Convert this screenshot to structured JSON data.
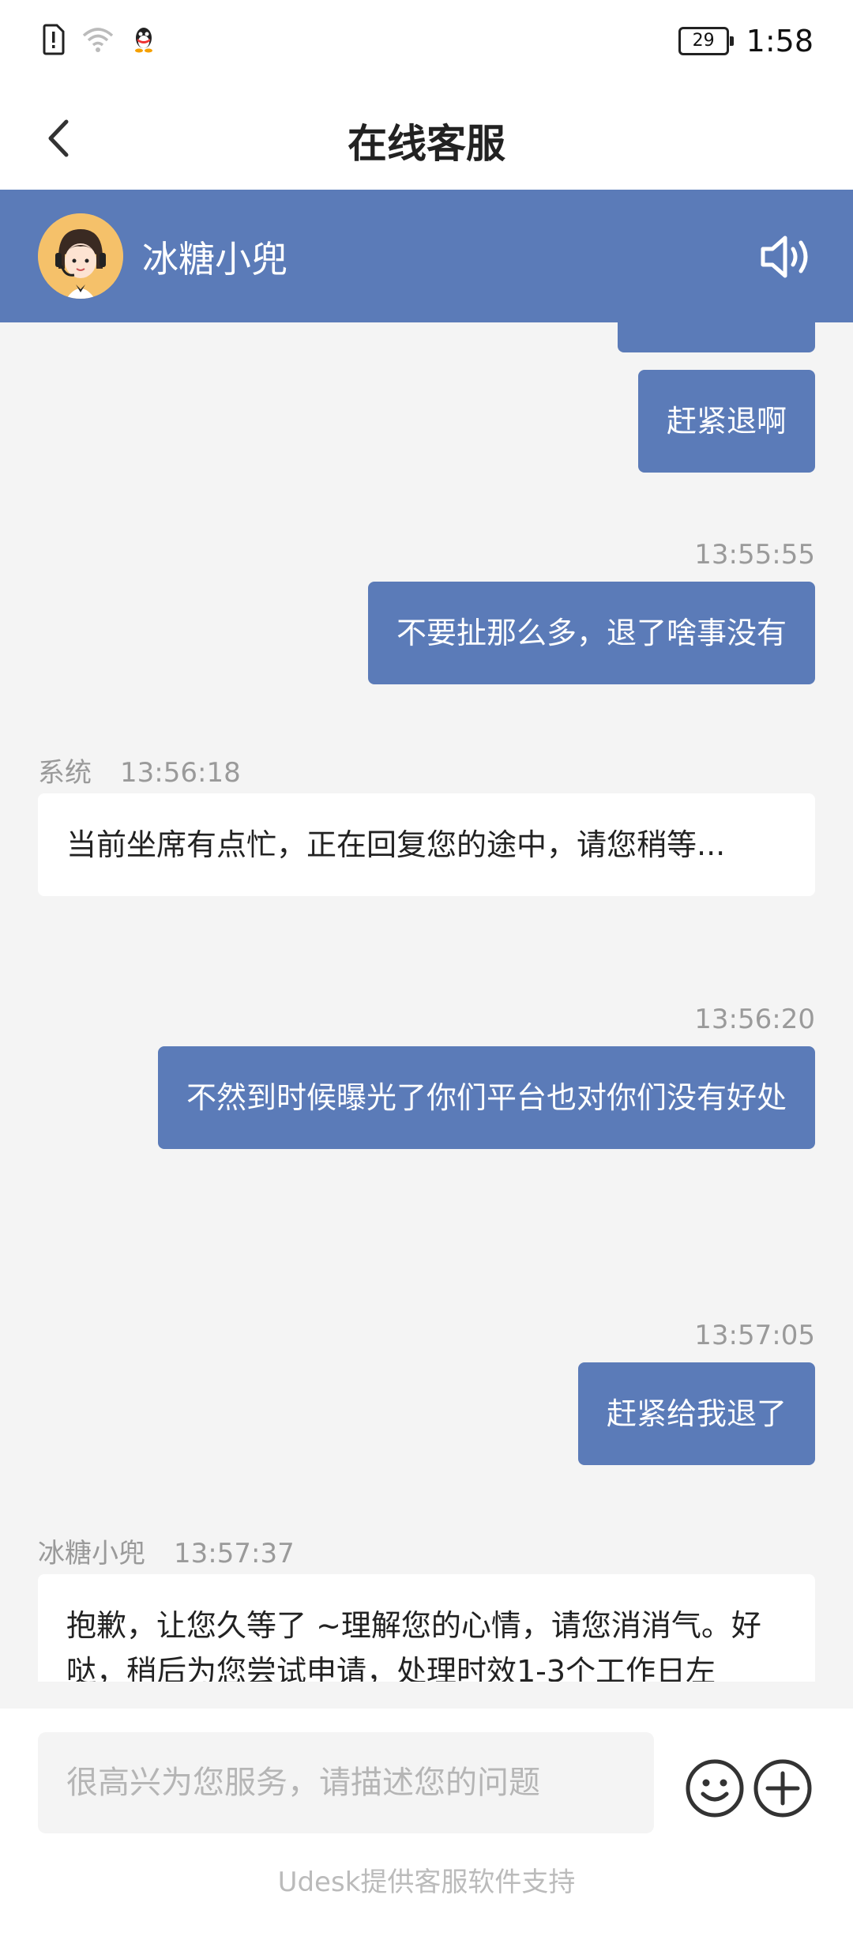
{
  "status_bar": {
    "time": "1:58",
    "battery": "29",
    "icons": [
      "sim-alert-icon",
      "wifi-icon",
      "qq-penguin-icon"
    ]
  },
  "nav": {
    "back_icon": "chevron-left-icon",
    "title": "在线客服"
  },
  "agent_bar": {
    "name": "冰糖小兜",
    "speaker_icon": "speaker-icon",
    "bg_color": "#5b7bb8"
  },
  "messages": [
    {
      "side": "right",
      "text": "赶紧退啊"
    },
    {
      "side": "right",
      "time": "13:55:55",
      "text": "不要扯那么多，退了啥事没有"
    },
    {
      "side": "left",
      "sender": "系统",
      "time": "13:56:18",
      "text": "当前坐席有点忙，正在回复您的途中，请您稍等..."
    },
    {
      "side": "right",
      "time": "13:56:20",
      "text": "不然到时候曝光了你们平台也对你们没有好处"
    },
    {
      "side": "right",
      "time": "13:57:05",
      "text": "赶紧给我退了"
    },
    {
      "side": "left",
      "sender": "冰糖小兜",
      "time": "13:57:37",
      "text": "抱歉，让您久等了 ~理解您的心情，请您消消气。好哒，稍后为您尝试申请，处理时效1-3个工作日左"
    }
  ],
  "composer": {
    "placeholder": "很高兴为您服务，请描述您的问题",
    "emoji_icon": "emoji-icon",
    "plus_icon": "plus-icon"
  },
  "footer": {
    "powered_by": "Udesk提供客服软件支持"
  }
}
